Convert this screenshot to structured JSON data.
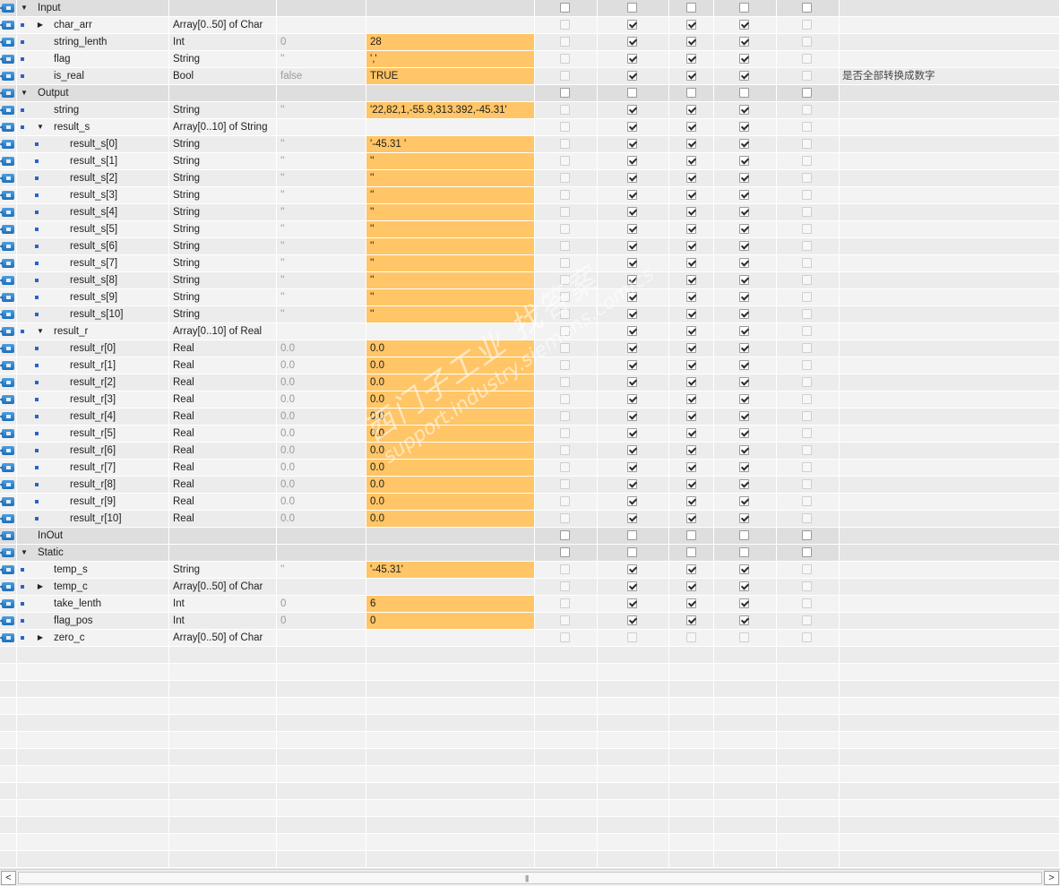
{
  "rows": [
    {
      "kind": "section",
      "icon": true,
      "dot": false,
      "level": 0,
      "expander": "down",
      "name": "Input",
      "type": "",
      "default": "",
      "monitor": "",
      "hl": false,
      "cb": [
        0,
        0,
        0,
        0,
        0
      ],
      "en": [
        1,
        1,
        1,
        1,
        1
      ],
      "comment": ""
    },
    {
      "kind": "var",
      "icon": true,
      "dot": true,
      "level": 1,
      "expander": "right",
      "name": "char_arr",
      "type": "Array[0..50] of Char",
      "default": "",
      "monitor": "",
      "hl": false,
      "cb": [
        0,
        1,
        1,
        1,
        0
      ],
      "en": [
        0,
        1,
        1,
        1,
        0
      ],
      "comment": ""
    },
    {
      "kind": "var",
      "icon": true,
      "dot": true,
      "level": 1,
      "expander": "",
      "name": "string_lenth",
      "type": "Int",
      "default": "0",
      "monitor": "28",
      "hl": true,
      "cb": [
        0,
        1,
        1,
        1,
        0
      ],
      "en": [
        0,
        1,
        1,
        1,
        0
      ],
      "comment": ""
    },
    {
      "kind": "var",
      "icon": true,
      "dot": true,
      "level": 1,
      "expander": "",
      "name": "flag",
      "type": "String",
      "default": "''",
      "monitor": "','",
      "hl": true,
      "cb": [
        0,
        1,
        1,
        1,
        0
      ],
      "en": [
        0,
        1,
        1,
        1,
        0
      ],
      "comment": ""
    },
    {
      "kind": "var",
      "icon": true,
      "dot": true,
      "level": 1,
      "expander": "",
      "name": "is_real",
      "type": "Bool",
      "default": "false",
      "monitor": "TRUE",
      "hl": true,
      "cb": [
        0,
        1,
        1,
        1,
        0
      ],
      "en": [
        0,
        1,
        1,
        1,
        0
      ],
      "comment": "是否全部转换成数字"
    },
    {
      "kind": "section",
      "icon": true,
      "dot": false,
      "level": 0,
      "expander": "down",
      "name": "Output",
      "type": "",
      "default": "",
      "monitor": "",
      "hl": false,
      "cb": [
        0,
        0,
        0,
        0,
        0
      ],
      "en": [
        1,
        1,
        1,
        1,
        1
      ],
      "comment": ""
    },
    {
      "kind": "var",
      "icon": true,
      "dot": true,
      "level": 1,
      "expander": "",
      "name": "string",
      "type": "String",
      "default": "''",
      "monitor": "'22,82,1,-55.9,313.392,-45.31'",
      "hl": true,
      "cb": [
        0,
        1,
        1,
        1,
        0
      ],
      "en": [
        0,
        1,
        1,
        1,
        0
      ],
      "comment": ""
    },
    {
      "kind": "var",
      "icon": true,
      "dot": true,
      "level": 1,
      "expander": "down",
      "name": "result_s",
      "type": "Array[0..10] of String",
      "default": "",
      "monitor": "",
      "hl": false,
      "cb": [
        0,
        1,
        1,
        1,
        0
      ],
      "en": [
        0,
        1,
        1,
        1,
        0
      ],
      "comment": ""
    },
    {
      "kind": "var",
      "icon": true,
      "dot": true,
      "level": 2,
      "expander": "",
      "name": "result_s[0]",
      "type": "String",
      "default": "''",
      "monitor": "'-45.31                                  '",
      "hl": true,
      "cb": [
        0,
        1,
        1,
        1,
        0
      ],
      "en": [
        0,
        1,
        1,
        1,
        0
      ],
      "comment": ""
    },
    {
      "kind": "var",
      "icon": true,
      "dot": true,
      "level": 2,
      "expander": "",
      "name": "result_s[1]",
      "type": "String",
      "default": "''",
      "monitor": "''",
      "hl": true,
      "cb": [
        0,
        1,
        1,
        1,
        0
      ],
      "en": [
        0,
        1,
        1,
        1,
        0
      ],
      "comment": ""
    },
    {
      "kind": "var",
      "icon": true,
      "dot": true,
      "level": 2,
      "expander": "",
      "name": "result_s[2]",
      "type": "String",
      "default": "''",
      "monitor": "''",
      "hl": true,
      "cb": [
        0,
        1,
        1,
        1,
        0
      ],
      "en": [
        0,
        1,
        1,
        1,
        0
      ],
      "comment": ""
    },
    {
      "kind": "var",
      "icon": true,
      "dot": true,
      "level": 2,
      "expander": "",
      "name": "result_s[3]",
      "type": "String",
      "default": "''",
      "monitor": "''",
      "hl": true,
      "cb": [
        0,
        1,
        1,
        1,
        0
      ],
      "en": [
        0,
        1,
        1,
        1,
        0
      ],
      "comment": ""
    },
    {
      "kind": "var",
      "icon": true,
      "dot": true,
      "level": 2,
      "expander": "",
      "name": "result_s[4]",
      "type": "String",
      "default": "''",
      "monitor": "''",
      "hl": true,
      "cb": [
        0,
        1,
        1,
        1,
        0
      ],
      "en": [
        0,
        1,
        1,
        1,
        0
      ],
      "comment": ""
    },
    {
      "kind": "var",
      "icon": true,
      "dot": true,
      "level": 2,
      "expander": "",
      "name": "result_s[5]",
      "type": "String",
      "default": "''",
      "monitor": "''",
      "hl": true,
      "cb": [
        0,
        1,
        1,
        1,
        0
      ],
      "en": [
        0,
        1,
        1,
        1,
        0
      ],
      "comment": ""
    },
    {
      "kind": "var",
      "icon": true,
      "dot": true,
      "level": 2,
      "expander": "",
      "name": "result_s[6]",
      "type": "String",
      "default": "''",
      "monitor": "''",
      "hl": true,
      "cb": [
        0,
        1,
        1,
        1,
        0
      ],
      "en": [
        0,
        1,
        1,
        1,
        0
      ],
      "comment": ""
    },
    {
      "kind": "var",
      "icon": true,
      "dot": true,
      "level": 2,
      "expander": "",
      "name": "result_s[7]",
      "type": "String",
      "default": "''",
      "monitor": "''",
      "hl": true,
      "cb": [
        0,
        1,
        1,
        1,
        0
      ],
      "en": [
        0,
        1,
        1,
        1,
        0
      ],
      "comment": ""
    },
    {
      "kind": "var",
      "icon": true,
      "dot": true,
      "level": 2,
      "expander": "",
      "name": "result_s[8]",
      "type": "String",
      "default": "''",
      "monitor": "''",
      "hl": true,
      "cb": [
        0,
        1,
        1,
        1,
        0
      ],
      "en": [
        0,
        1,
        1,
        1,
        0
      ],
      "comment": ""
    },
    {
      "kind": "var",
      "icon": true,
      "dot": true,
      "level": 2,
      "expander": "",
      "name": "result_s[9]",
      "type": "String",
      "default": "''",
      "monitor": "''",
      "hl": true,
      "cb": [
        0,
        1,
        1,
        1,
        0
      ],
      "en": [
        0,
        1,
        1,
        1,
        0
      ],
      "comment": ""
    },
    {
      "kind": "var",
      "icon": true,
      "dot": true,
      "level": 2,
      "expander": "",
      "name": "result_s[10]",
      "type": "String",
      "default": "''",
      "monitor": "''",
      "hl": true,
      "cb": [
        0,
        1,
        1,
        1,
        0
      ],
      "en": [
        0,
        1,
        1,
        1,
        0
      ],
      "comment": ""
    },
    {
      "kind": "var",
      "icon": true,
      "dot": true,
      "level": 1,
      "expander": "down",
      "name": "result_r",
      "type": "Array[0..10] of Real",
      "default": "",
      "monitor": "",
      "hl": false,
      "cb": [
        0,
        1,
        1,
        1,
        0
      ],
      "en": [
        0,
        1,
        1,
        1,
        0
      ],
      "comment": ""
    },
    {
      "kind": "var",
      "icon": true,
      "dot": true,
      "level": 2,
      "expander": "",
      "name": "result_r[0]",
      "type": "Real",
      "default": "0.0",
      "monitor": "0.0",
      "hl": true,
      "cb": [
        0,
        1,
        1,
        1,
        0
      ],
      "en": [
        0,
        1,
        1,
        1,
        0
      ],
      "comment": ""
    },
    {
      "kind": "var",
      "icon": true,
      "dot": true,
      "level": 2,
      "expander": "",
      "name": "result_r[1]",
      "type": "Real",
      "default": "0.0",
      "monitor": "0.0",
      "hl": true,
      "cb": [
        0,
        1,
        1,
        1,
        0
      ],
      "en": [
        0,
        1,
        1,
        1,
        0
      ],
      "comment": ""
    },
    {
      "kind": "var",
      "icon": true,
      "dot": true,
      "level": 2,
      "expander": "",
      "name": "result_r[2]",
      "type": "Real",
      "default": "0.0",
      "monitor": "0.0",
      "hl": true,
      "cb": [
        0,
        1,
        1,
        1,
        0
      ],
      "en": [
        0,
        1,
        1,
        1,
        0
      ],
      "comment": ""
    },
    {
      "kind": "var",
      "icon": true,
      "dot": true,
      "level": 2,
      "expander": "",
      "name": "result_r[3]",
      "type": "Real",
      "default": "0.0",
      "monitor": "0.0",
      "hl": true,
      "cb": [
        0,
        1,
        1,
        1,
        0
      ],
      "en": [
        0,
        1,
        1,
        1,
        0
      ],
      "comment": ""
    },
    {
      "kind": "var",
      "icon": true,
      "dot": true,
      "level": 2,
      "expander": "",
      "name": "result_r[4]",
      "type": "Real",
      "default": "0.0",
      "monitor": "0.0",
      "hl": true,
      "cb": [
        0,
        1,
        1,
        1,
        0
      ],
      "en": [
        0,
        1,
        1,
        1,
        0
      ],
      "comment": ""
    },
    {
      "kind": "var",
      "icon": true,
      "dot": true,
      "level": 2,
      "expander": "",
      "name": "result_r[5]",
      "type": "Real",
      "default": "0.0",
      "monitor": "0.0",
      "hl": true,
      "cb": [
        0,
        1,
        1,
        1,
        0
      ],
      "en": [
        0,
        1,
        1,
        1,
        0
      ],
      "comment": ""
    },
    {
      "kind": "var",
      "icon": true,
      "dot": true,
      "level": 2,
      "expander": "",
      "name": "result_r[6]",
      "type": "Real",
      "default": "0.0",
      "monitor": "0.0",
      "hl": true,
      "cb": [
        0,
        1,
        1,
        1,
        0
      ],
      "en": [
        0,
        1,
        1,
        1,
        0
      ],
      "comment": ""
    },
    {
      "kind": "var",
      "icon": true,
      "dot": true,
      "level": 2,
      "expander": "",
      "name": "result_r[7]",
      "type": "Real",
      "default": "0.0",
      "monitor": "0.0",
      "hl": true,
      "cb": [
        0,
        1,
        1,
        1,
        0
      ],
      "en": [
        0,
        1,
        1,
        1,
        0
      ],
      "comment": ""
    },
    {
      "kind": "var",
      "icon": true,
      "dot": true,
      "level": 2,
      "expander": "",
      "name": "result_r[8]",
      "type": "Real",
      "default": "0.0",
      "monitor": "0.0",
      "hl": true,
      "cb": [
        0,
        1,
        1,
        1,
        0
      ],
      "en": [
        0,
        1,
        1,
        1,
        0
      ],
      "comment": ""
    },
    {
      "kind": "var",
      "icon": true,
      "dot": true,
      "level": 2,
      "expander": "",
      "name": "result_r[9]",
      "type": "Real",
      "default": "0.0",
      "monitor": "0.0",
      "hl": true,
      "cb": [
        0,
        1,
        1,
        1,
        0
      ],
      "en": [
        0,
        1,
        1,
        1,
        0
      ],
      "comment": ""
    },
    {
      "kind": "var",
      "icon": true,
      "dot": true,
      "level": 2,
      "expander": "",
      "name": "result_r[10]",
      "type": "Real",
      "default": "0.0",
      "monitor": "0.0",
      "hl": true,
      "cb": [
        0,
        1,
        1,
        1,
        0
      ],
      "en": [
        0,
        1,
        1,
        1,
        0
      ],
      "comment": ""
    },
    {
      "kind": "section",
      "icon": true,
      "dot": false,
      "level": 0,
      "expander": "",
      "name": "InOut",
      "type": "",
      "default": "",
      "monitor": "",
      "hl": false,
      "cb": [
        0,
        0,
        0,
        0,
        0
      ],
      "en": [
        1,
        1,
        1,
        1,
        1
      ],
      "comment": ""
    },
    {
      "kind": "section",
      "icon": true,
      "dot": false,
      "level": 0,
      "expander": "down",
      "name": "Static",
      "type": "",
      "default": "",
      "monitor": "",
      "hl": false,
      "cb": [
        0,
        0,
        0,
        0,
        0
      ],
      "en": [
        1,
        1,
        1,
        1,
        1
      ],
      "comment": ""
    },
    {
      "kind": "var",
      "icon": true,
      "dot": true,
      "level": 1,
      "expander": "",
      "name": "temp_s",
      "type": "String",
      "default": "''",
      "monitor": "'-45.31'",
      "hl": true,
      "cb": [
        0,
        1,
        1,
        1,
        0
      ],
      "en": [
        0,
        1,
        1,
        1,
        0
      ],
      "comment": ""
    },
    {
      "kind": "var",
      "icon": true,
      "dot": true,
      "level": 1,
      "expander": "right",
      "name": "temp_c",
      "type": "Array[0..50] of Char",
      "default": "",
      "monitor": "",
      "hl": false,
      "cb": [
        0,
        1,
        1,
        1,
        0
      ],
      "en": [
        0,
        1,
        1,
        1,
        0
      ],
      "comment": ""
    },
    {
      "kind": "var",
      "icon": true,
      "dot": true,
      "level": 1,
      "expander": "",
      "name": "take_lenth",
      "type": "Int",
      "default": "0",
      "monitor": "6",
      "hl": true,
      "cb": [
        0,
        1,
        1,
        1,
        0
      ],
      "en": [
        0,
        1,
        1,
        1,
        0
      ],
      "comment": ""
    },
    {
      "kind": "var",
      "icon": true,
      "dot": true,
      "level": 1,
      "expander": "",
      "name": "flag_pos",
      "type": "Int",
      "default": "0",
      "monitor": "0",
      "hl": true,
      "cb": [
        0,
        1,
        1,
        1,
        0
      ],
      "en": [
        0,
        1,
        1,
        1,
        0
      ],
      "comment": ""
    },
    {
      "kind": "var",
      "icon": true,
      "dot": true,
      "level": 1,
      "expander": "right",
      "name": "zero_c",
      "type": "Array[0..50] of Char",
      "default": "",
      "monitor": "",
      "hl": false,
      "cb": [
        0,
        0,
        0,
        0,
        0
      ],
      "en": [
        0,
        0,
        0,
        0,
        0
      ],
      "comment": ""
    }
  ],
  "empty_rows": 13,
  "watermark": {
    "line1": "西门子工业 找答案",
    "line2": "support.industry.siemens.com/cs"
  },
  "scrollbar": {
    "left_arrow": "<",
    "right_arrow": ">",
    "grip": "|||"
  },
  "colors": {
    "monitor_highlight": "#ffc566",
    "row_icon": "#2a7fd0",
    "bullet": "#2a63c8"
  },
  "icons": {
    "row": "db-row-icon",
    "expand_down": "caret-down-icon",
    "expand_right": "caret-right-icon",
    "bullet": "member-bullet-icon"
  }
}
